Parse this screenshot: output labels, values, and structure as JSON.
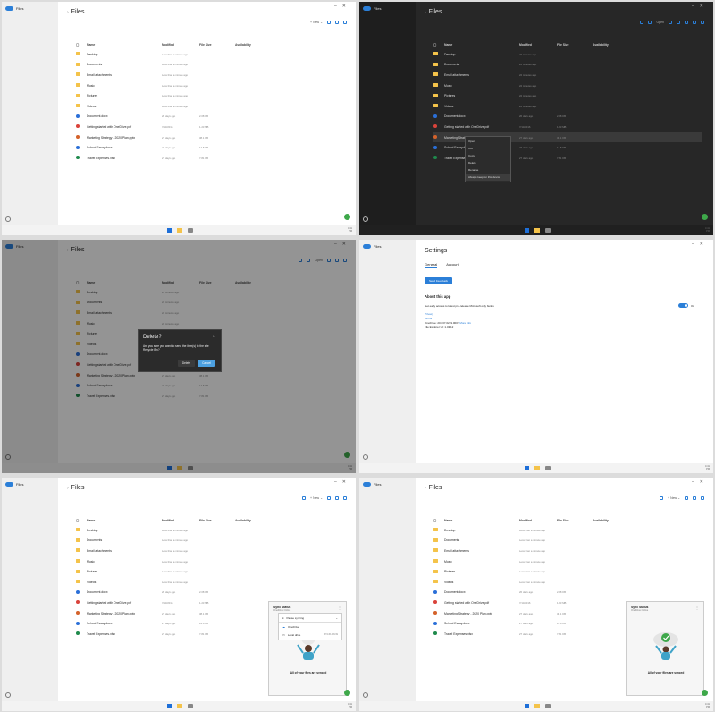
{
  "app": {
    "name": "Files",
    "page_title": "Files",
    "settings_title": "Settings"
  },
  "toolbar": {
    "new_label": "New",
    "open_label": "Open"
  },
  "columns": {
    "name": "Name",
    "modified": "Modified",
    "size": "File Size",
    "availability": "Availability"
  },
  "files_light": [
    {
      "name": "Desktop",
      "type": "folder",
      "modified": "Less than a minute ago",
      "size": ""
    },
    {
      "name": "Documents",
      "type": "folder",
      "modified": "Less than a minute ago",
      "size": ""
    },
    {
      "name": "Email attachments",
      "type": "folder",
      "modified": "Less than a minute ago",
      "size": ""
    },
    {
      "name": "Music",
      "type": "folder",
      "modified": "Less than a minute ago",
      "size": ""
    },
    {
      "name": "Pictures",
      "type": "folder",
      "modified": "Less than a minute ago",
      "size": ""
    },
    {
      "name": "Videos",
      "type": "folder",
      "modified": "Less than a minute ago",
      "size": ""
    },
    {
      "name": "Document.docx",
      "type": "docx",
      "modified": "26 days ago",
      "size": "2.08 KB"
    },
    {
      "name": "Getting started with OneDrive.pdf",
      "type": "pdf",
      "modified": "7/13/2016",
      "size": "1.23 MB"
    },
    {
      "name": "Marketing Strategy - 2020 Plan.pptx",
      "type": "pptx",
      "modified": "27 days ago",
      "size": "38.1 KB"
    },
    {
      "name": "School Essay.docx",
      "type": "docx",
      "modified": "27 days ago",
      "size": "14.8 KB"
    },
    {
      "name": "Travel Expenses.xlsx",
      "type": "xlsx",
      "modified": "27 days ago",
      "size": "7.81 KB"
    }
  ],
  "files_dark_modified": [
    "22 minutes ago",
    "22 minutes ago",
    "22 minutes ago",
    "22 minutes ago",
    "22 minutes ago",
    "22 minutes ago",
    "26 days ago",
    "7/13/2016",
    "27 days ago",
    "27 days ago",
    "27 days ago"
  ],
  "context_menu": [
    "Open",
    "Cut",
    "Copy",
    "Delete",
    "Rename",
    "Always keep on this device"
  ],
  "delete_dialog": {
    "title": "Delete?",
    "message": "Are you sure you want to send the item(s) to the site Recycle Bin?",
    "delete_label": "Delete",
    "cancel_label": "Cancel"
  },
  "settings": {
    "tab_general": "General",
    "tab_account": "Account",
    "send_feedback": "Send Feedback",
    "about_heading": "About this app",
    "early_access": "Get early access to latest pre-release Microsoft only builds",
    "toggle_label": "On",
    "privacy": "Privacy",
    "terms": "Terms",
    "onedrive_version": "OneDrive: 20.037.0219.0002",
    "more_info": "More Info",
    "file_explorer_version": "File Explorer UI: 1.43.12"
  },
  "sync_flyout": {
    "title": "Sync Status",
    "subtitle": "OneDrive Online",
    "message": "All of your files are synced",
    "menu": [
      {
        "label": "Pause syncing",
        "meta": ""
      },
      {
        "label": "OneDrive",
        "meta": ""
      },
      {
        "label": "Local drive",
        "meta": "37/136 / 99.99"
      }
    ]
  },
  "clock": {
    "time": "4:41",
    "date": "PM"
  },
  "colors": {
    "accent": "#2b7fd8",
    "folder": "#f4c34a",
    "sync_ok": "#3ea84a",
    "dark_bg": "#272727"
  }
}
